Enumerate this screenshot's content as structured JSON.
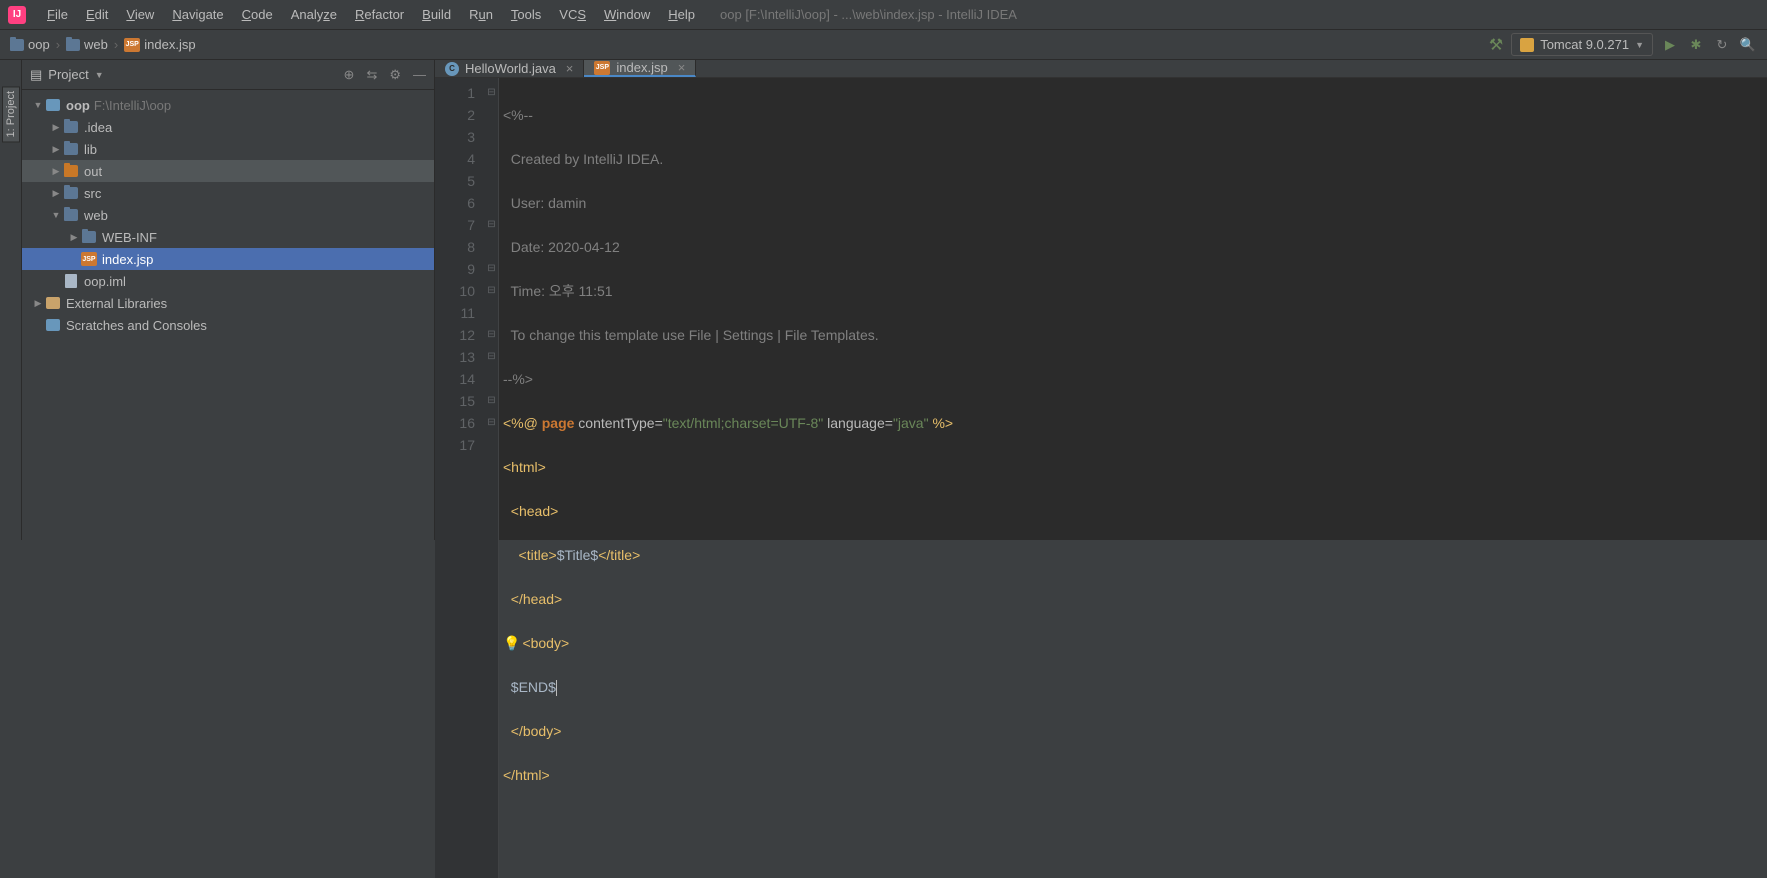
{
  "menu": {
    "items": [
      "File",
      "Edit",
      "View",
      "Navigate",
      "Code",
      "Analyze",
      "Refactor",
      "Build",
      "Run",
      "Tools",
      "VCS",
      "Window",
      "Help"
    ],
    "title": "oop [F:\\IntelliJ\\oop] - ...\\web\\index.jsp - IntelliJ IDEA"
  },
  "breadcrumb": {
    "items": [
      {
        "icon": "folder",
        "label": "oop"
      },
      {
        "icon": "folder",
        "label": "web"
      },
      {
        "icon": "jsp",
        "label": "index.jsp"
      }
    ]
  },
  "runconfig": {
    "label": "Tomcat 9.0.271"
  },
  "panel": {
    "title": "Project",
    "vtab": "1: Project"
  },
  "tree": {
    "root": {
      "label": "oop",
      "path": "F:\\IntelliJ\\oop"
    },
    "idea": ".idea",
    "lib": "lib",
    "out": "out",
    "src": "src",
    "web": "web",
    "webinf": "WEB-INF",
    "indexjsp": "index.jsp",
    "oopiml": "oop.iml",
    "extlib": "External Libraries",
    "scratch": "Scratches and Consoles"
  },
  "tabs": {
    "hello": "HelloWorld.java",
    "index": "index.jsp"
  },
  "code": {
    "l1": "<%--",
    "l2": "  Created by IntelliJ IDEA.",
    "l3": "  User: damin",
    "l4": "  Date: 2020-04-12",
    "l5": "  Time: 오후 11:51",
    "l6": "  To change this template use File | Settings | File Templates.",
    "l7": "--%>",
    "l8_pre": "<%@ ",
    "l8_key": "page",
    "l8_at1": " contentType=",
    "l8_s1": "\"text/html;charset=UTF-8\"",
    "l8_at2": " language=",
    "l8_s2": "\"java\"",
    "l8_end": " %>",
    "l9": "<html>",
    "l10": "  <head>",
    "l11a": "    <title>",
    "l11b": "$Title$",
    "l11c": "</title>",
    "l12": "  </head>",
    "l13": "<body>",
    "l14": "$END$",
    "l15": "  </body>",
    "l16": "</html>"
  },
  "lines": [
    "1",
    "2",
    "3",
    "4",
    "5",
    "6",
    "7",
    "8",
    "9",
    "10",
    "11",
    "12",
    "13",
    "14",
    "15",
    "16",
    "17"
  ]
}
